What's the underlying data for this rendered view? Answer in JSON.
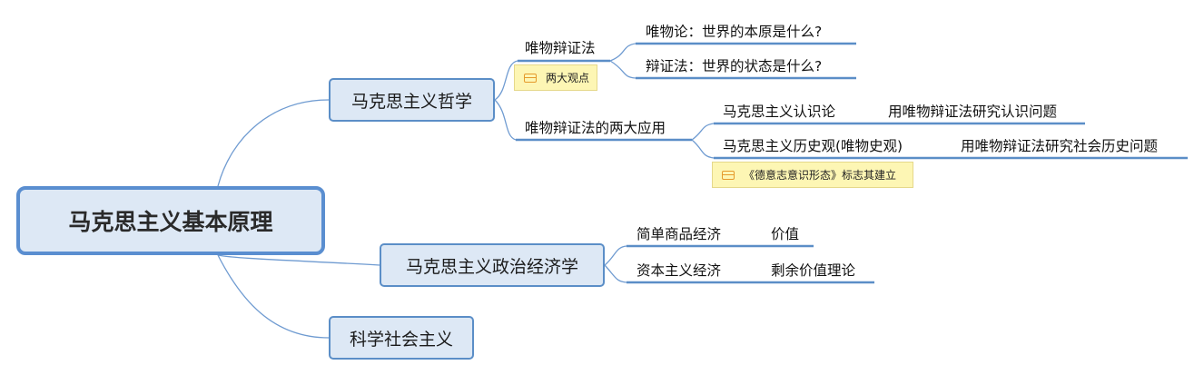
{
  "root": "马克思主义基本原理",
  "branches": {
    "philosophy": {
      "label": "马克思主义哲学",
      "materialist_dialectics": {
        "label": "唯物辩证法",
        "note": "两大观点",
        "children": [
          "唯物论：世界的本原是什么?",
          "辩证法：世界的状态是什么?"
        ]
      },
      "applications": {
        "label": "唯物辩证法的两大应用",
        "epistemology": {
          "label": "马克思主义认识论",
          "child": "用唯物辩证法研究认识问题"
        },
        "history": {
          "label": "马克思主义历史观(唯物史观)",
          "child": "用唯物辩证法研究社会历史问题",
          "note": "《德意志意识形态》标志其建立"
        }
      }
    },
    "political_economy": {
      "label": "马克思主义政治经济学",
      "simple": {
        "label": "简单商品经济",
        "child": "价值"
      },
      "capitalist": {
        "label": "资本主义经济",
        "child": "剩余价值理论"
      }
    },
    "socialism": {
      "label": "科学社会主义"
    }
  },
  "colors": {
    "line": "#5b8ec7",
    "node_fill": "#dde8f5",
    "note_fill": "#fdf6b4",
    "note_icon": "#e59a2b"
  }
}
